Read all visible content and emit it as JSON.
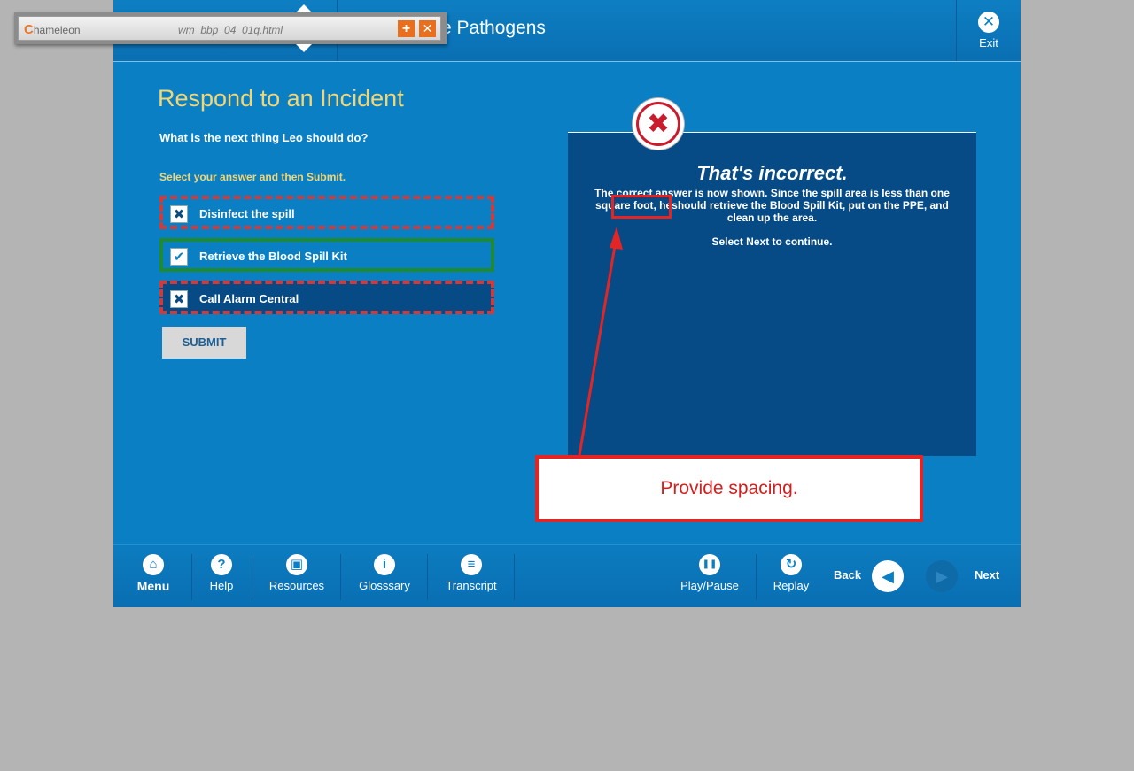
{
  "viewer": {
    "logo_initial": "C",
    "logo_rest": "hameleon",
    "filename": "wm_bbp_04_01q.html",
    "add_symbol": "+",
    "close_symbol": "✕"
  },
  "header": {
    "title": "e Pathogens",
    "exit_label": "Exit",
    "exit_icon_glyph": "✕"
  },
  "question": {
    "heading": "Respond to an Incident",
    "prompt": "What is the next thing Leo should do?",
    "instruction": "Select your answer and then Submit.",
    "options": [
      {
        "label": "Disinfect the spill",
        "state": "incorrect",
        "glyph": "✖"
      },
      {
        "label": "Retrieve the Blood Spill Kit",
        "state": "correct",
        "glyph": "✔"
      },
      {
        "label": "Call Alarm Central",
        "state": "incorrect-selected",
        "glyph": "✖"
      }
    ],
    "submit_label": "SUBMIT"
  },
  "feedback": {
    "icon_glyph": "✖",
    "title": "That's incorrect.",
    "body": "The correct answer is now shown.  Since the spill area is less than one square foot, heshould retrieve the Blood Spill Kit, put on the PPE, and clean up the area.",
    "next_hint": "Select Next to continue."
  },
  "footer": {
    "menu": {
      "label": "Menu",
      "icon": "home-icon",
      "glyph": "⌂"
    },
    "help": {
      "label": "Help",
      "icon": "help-icon",
      "glyph": "?"
    },
    "resources": {
      "label": "Resources",
      "icon": "resources-icon",
      "glyph": "▣"
    },
    "glossary": {
      "label": "Glosssary",
      "icon": "info-icon",
      "glyph": "i"
    },
    "transcript": {
      "label": "Transcript",
      "icon": "list-icon",
      "glyph": "≡"
    },
    "playpause": {
      "label": "Play/Pause",
      "icon": "pause-icon",
      "glyph": "❚❚"
    },
    "replay": {
      "label": "Replay",
      "icon": "replay-icon",
      "glyph": "↻"
    },
    "back": {
      "label": "Back",
      "glyph": "◀"
    },
    "next": {
      "label": "Next",
      "glyph": "▶"
    }
  },
  "annotation": {
    "callout_text": "Provide spacing.",
    "color": "#e52424"
  },
  "colors": {
    "stage_blue": "#0b7fc4",
    "panel_dark_blue": "#064b86",
    "heading_gold": "#f2d675",
    "correct_green": "#1e8a32",
    "incorrect_red": "#d23a3a"
  }
}
